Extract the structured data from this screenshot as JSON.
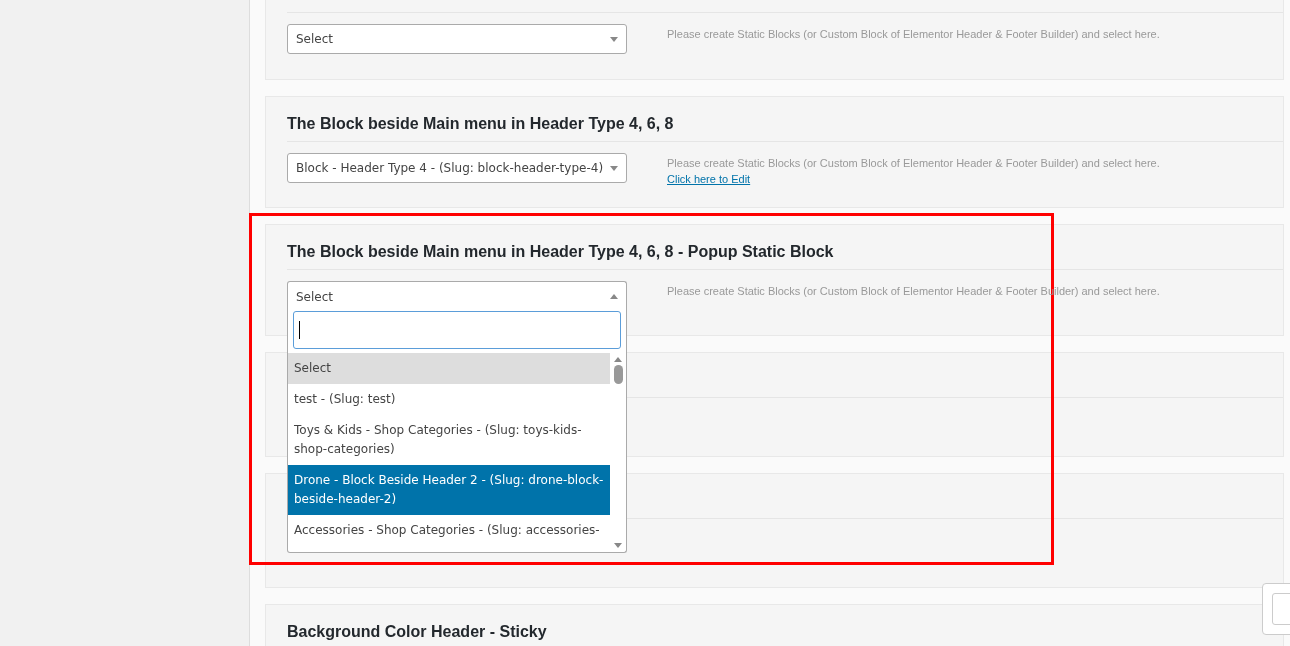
{
  "sections": [
    {
      "select": {
        "value": "Select",
        "open": false
      },
      "hint": "Please create Static Blocks (or Custom Block of Elementor Header & Footer Builder) and select here."
    },
    {
      "title": "The Block beside Main menu in Header Type 4, 6, 8",
      "select": {
        "value": "Block - Header Type 4 - (Slug: block-header-type-4)",
        "open": false
      },
      "hint": "Please create Static Blocks (or Custom Block of Elementor Header & Footer Builder) and select here.",
      "link": "Click here to Edit"
    },
    {
      "title": "The Block beside Main menu in Header Type 4, 6, 8 - Popup Static Block",
      "select": {
        "value": "Select",
        "open": true
      },
      "hint": "Please create Static Blocks (or Custom Block of Elementor Header & Footer Builder) and select here.",
      "dropdown": {
        "options": [
          {
            "label": "Select",
            "selected": true,
            "highlighted": false
          },
          {
            "label": "test - (Slug: test)",
            "selected": false,
            "highlighted": false
          },
          {
            "label": "Toys & Kids - Shop Categories - (Slug: toys-kids-shop-categories)",
            "selected": false,
            "highlighted": false
          },
          {
            "label": "Drone - Block Beside Header 2 - (Slug: drone-block-beside-header-2)",
            "selected": false,
            "highlighted": true
          },
          {
            "label": "Accessories - Shop Categories - (Slug: accessories-",
            "selected": false,
            "highlighted": false
          }
        ]
      }
    },
    {
      "title": "Background Color Header - Sticky"
    }
  ]
}
